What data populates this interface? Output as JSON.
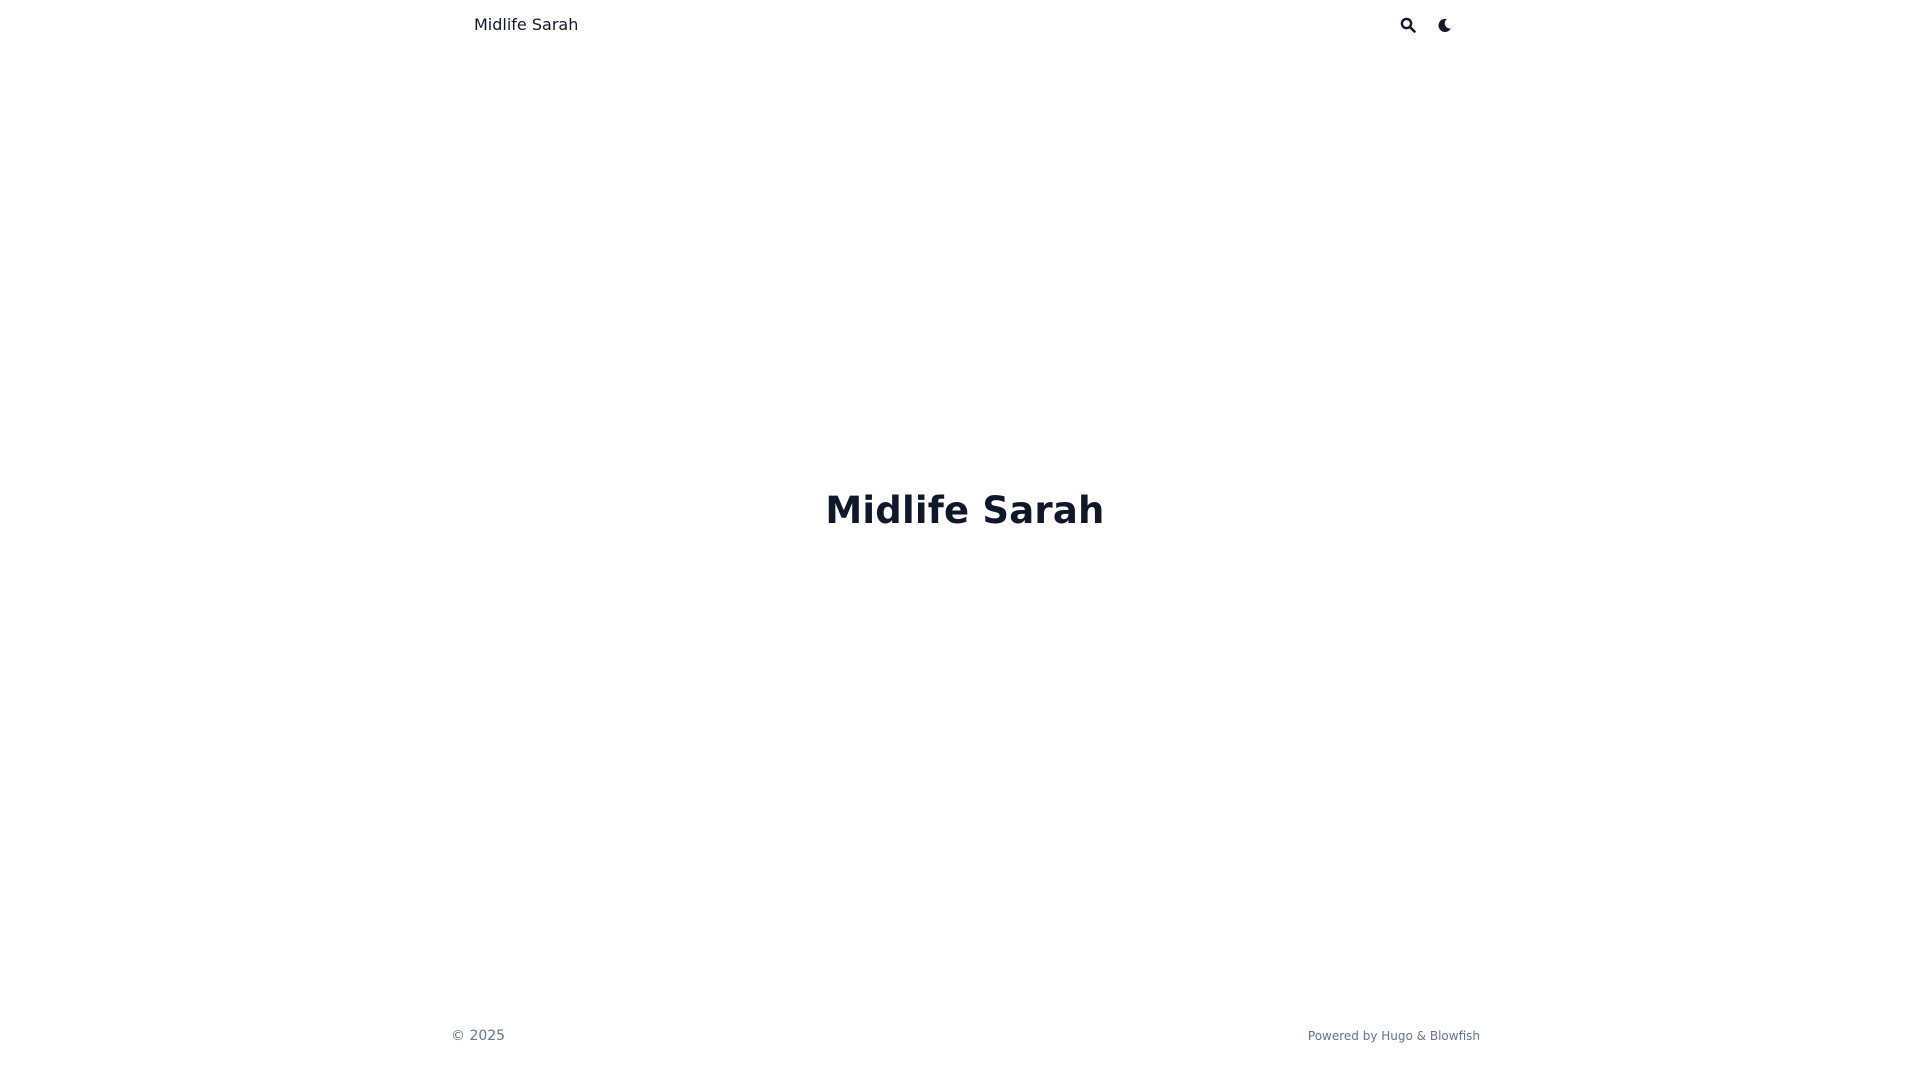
{
  "header": {
    "site_title": "Midlife Sarah",
    "icons": {
      "search": "search-icon",
      "theme_toggle": "moon-icon"
    }
  },
  "hero": {
    "title": "Midlife Sarah"
  },
  "footer": {
    "copyright": "© 2025",
    "powered_prefix": "Powered by ",
    "hugo_link": "Hugo",
    "separator": " & ",
    "blowfish_link": "Blowfish"
  },
  "colors": {
    "background": "#ffffff",
    "text_primary": "#0f172a",
    "text_muted": "#64748b"
  }
}
